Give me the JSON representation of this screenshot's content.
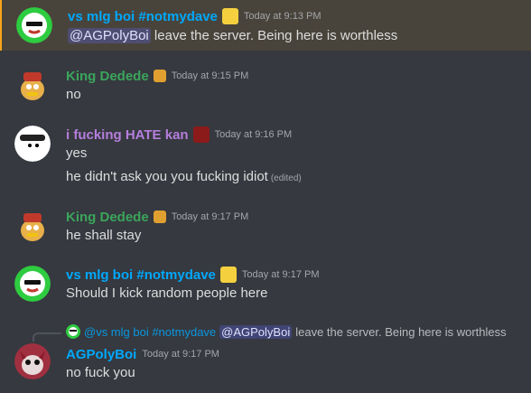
{
  "messages": [
    {
      "username": "vs mlg boi #notmydave",
      "username_color": "#00a8fc",
      "timestamp": "Today at 9:13 PM",
      "lines": [
        {
          "mention": "@AGPolyBoi",
          "text": " leave the server. Being here is worthless"
        }
      ]
    },
    {
      "username": "King Dedede",
      "username_color": "#3ba55c",
      "timestamp": "Today at 9:15 PM",
      "lines": [
        {
          "text": "no"
        }
      ]
    },
    {
      "username": "i fucking HATE kan",
      "username_color": "#b57edc",
      "timestamp": "Today at 9:16 PM",
      "lines": [
        {
          "text": "yes"
        },
        {
          "text": "he didn't ask you you fucking idiot",
          "edited": "(edited)"
        }
      ]
    },
    {
      "username": "King Dedede",
      "username_color": "#3ba55c",
      "timestamp": "Today at 9:17 PM",
      "lines": [
        {
          "text": "he shall stay"
        }
      ]
    },
    {
      "username": "vs mlg boi #notmydave",
      "username_color": "#00a8fc",
      "timestamp": "Today at 9:17 PM",
      "lines": [
        {
          "text": "Should I kick random people here"
        }
      ]
    },
    {
      "reply": {
        "username": "@vs mlg boi #notmydave",
        "mention": "@AGPolyBoi",
        "text": "leave the server. Being here is worthless"
      },
      "username": "AGPolyBoi",
      "username_color": "#00a8fc",
      "timestamp": "Today at 9:17 PM",
      "lines": [
        {
          "text": "no fuck you"
        }
      ]
    }
  ]
}
